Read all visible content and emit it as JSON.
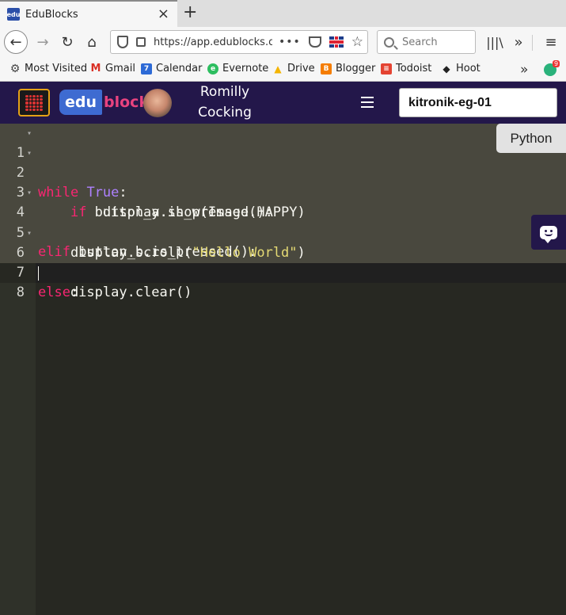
{
  "browser": {
    "tab": {
      "favicon_text": "edu",
      "title": "EduBlocks",
      "close_symbol": "×"
    },
    "new_tab_symbol": "+",
    "nav": {
      "back": "←",
      "forward": "→",
      "reload": "↻",
      "home": "⌂",
      "library": "|||\\",
      "overflow": "»",
      "menu": "≡"
    },
    "url": "https://app.edublocks.or",
    "url_more": "•••",
    "url_star": "☆",
    "search_placeholder": "Search",
    "bookmarks": [
      {
        "label": "Most Visited",
        "icon": "gear-icon",
        "color": "#444444",
        "glyph": "⚙"
      },
      {
        "label": "Gmail",
        "icon": "gmail-icon",
        "color": "#d93025",
        "glyph": "M"
      },
      {
        "label": "Calendar",
        "icon": "calendar-icon",
        "color": "#2d6ad6",
        "glyph": "7"
      },
      {
        "label": "Evernote",
        "icon": "evernote-icon",
        "color": "#2dbe60",
        "glyph": "e"
      },
      {
        "label": "Drive",
        "icon": "drive-icon",
        "color": "#f4b400",
        "glyph": "▲"
      },
      {
        "label": "Blogger",
        "icon": "blogger-icon",
        "color": "#f57d00",
        "glyph": "B"
      },
      {
        "label": "Todoist",
        "icon": "todoist-icon",
        "color": "#e44332",
        "glyph": "≡"
      },
      {
        "label": "Hoot",
        "icon": "owl-icon",
        "color": "#222222",
        "glyph": "◆"
      }
    ],
    "bookmarks_overflow": "»",
    "extension_badge": "9"
  },
  "app": {
    "brand_edu": "edu",
    "brand_blocks": "blocks",
    "user_first": "Romilly",
    "user_last": "Cocking",
    "project_name": "kitronik-eg-01",
    "python_tab": "Python"
  },
  "editor": {
    "line_numbers": [
      "1",
      "2",
      "3",
      "4",
      "5",
      "6",
      "7",
      "8"
    ]
  },
  "colors": {
    "header": "#23174a",
    "editor_bg": "#272822",
    "keyword": "#f92672",
    "constant": "#ae81ff",
    "string": "#e6db74"
  }
}
